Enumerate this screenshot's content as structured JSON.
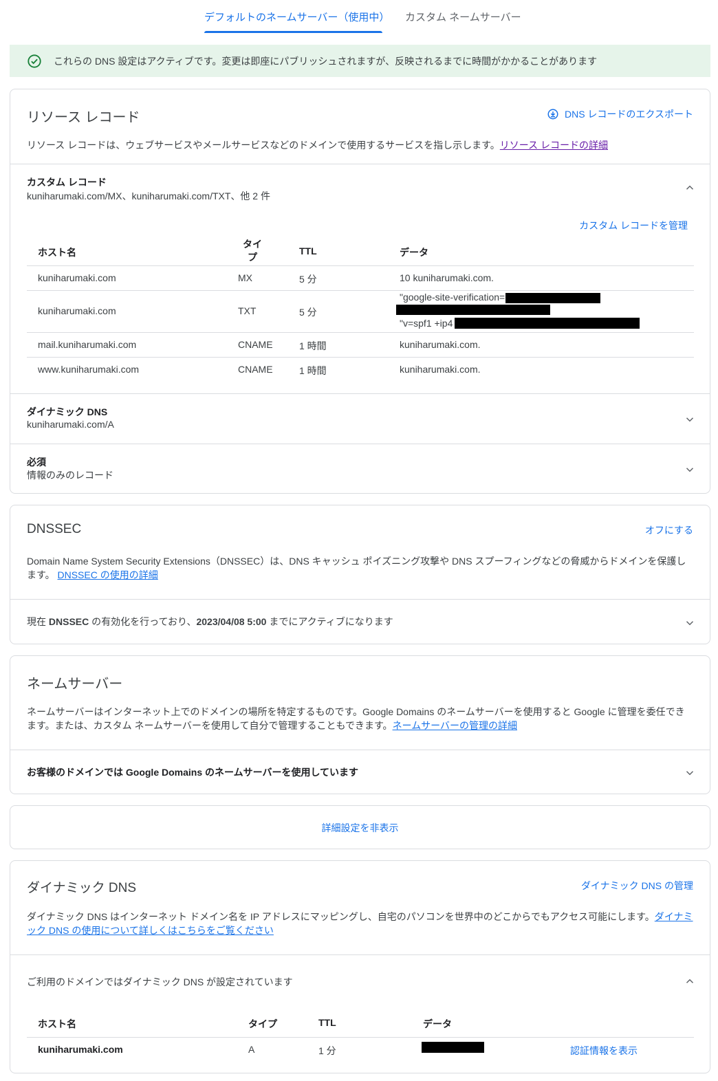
{
  "tabs": {
    "active": "デフォルトのネームサーバー（使用中）",
    "inactive": "カスタム ネームサーバー"
  },
  "banner": {
    "text": "これらの DNS 設定はアクティブです。変更は即座にパブリッシュされますが、反映されるまでに時間がかかることがあります",
    "icon": "check-circle-icon",
    "color": "#e6f4ea"
  },
  "resource_records": {
    "title": "リソース レコード",
    "export_label": "DNS レコードのエクスポート",
    "description": "リソース レコードは、ウェブサービスやメールサービスなどのドメインで使用するサービスを指し示します。",
    "learn_more": "リソース レコードの詳細",
    "custom": {
      "title": "カスタム レコード",
      "subtitle": "kuniharumaki.com/MX、kuniharumaki.com/TXT、他 2 件",
      "manage_label": "カスタム レコードを管理",
      "headers": {
        "host": "ホスト名",
        "type": "タイプ",
        "ttl": "TTL",
        "data": "データ"
      },
      "rows": [
        {
          "host": "kuniharumaki.com",
          "type": "MX",
          "ttl": "5 分",
          "data": "10 kuniharumaki.com."
        },
        {
          "host": "kuniharumaki.com",
          "type": "TXT",
          "ttl": "5 分",
          "data1": "\"google-site-verification=",
          "data2": "\"v=spf1 +ip4"
        },
        {
          "host": "mail.kuniharumaki.com",
          "type": "CNAME",
          "ttl": "1 時間",
          "data": "kuniharumaki.com."
        },
        {
          "host": "www.kuniharumaki.com",
          "type": "CNAME",
          "ttl": "1 時間",
          "data": "kuniharumaki.com."
        }
      ]
    },
    "dynamic": {
      "title": "ダイナミック DNS",
      "subtitle": "kuniharumaki.com/A"
    },
    "required": {
      "title": "必須",
      "subtitle": "情報のみのレコード"
    }
  },
  "dnssec": {
    "title": "DNSSEC",
    "action": "オフにする",
    "description": "Domain Name System Security Extensions（DNSSEC）は、DNS キャッシュ ポイズニング攻撃や DNS スプーフィングなどの脅威からドメインを保護します。",
    "learn_more": "DNSSEC の使用の詳細",
    "status_prefix": "現在 ",
    "status_b1": "DNSSEC",
    "status_mid": " の有効化を行っており、",
    "status_b2": "2023/04/08 5:00",
    "status_suffix": " までにアクティブになります"
  },
  "nameservers": {
    "title": "ネームサーバー",
    "description": "ネームサーバーはインターネット上でのドメインの場所を特定するものです。Google Domains のネームサーバーを使用すると Google に管理を委任できます。または、カスタム ネームサーバーを使用して自分で管理することもできます。",
    "learn_more": "ネームサーバーの管理の詳細",
    "status": "お客様のドメインでは Google Domains のネームサーバーを使用しています"
  },
  "advanced": {
    "toggle_label": "詳細設定を非表示"
  },
  "dynamic_dns": {
    "title": "ダイナミック DNS",
    "manage_label": "ダイナミック DNS の管理",
    "description": "ダイナミック DNS はインターネット ドメイン名を IP アドレスにマッピングし、自宅のパソコンを世界中のどこからでもアクセス可能にします。",
    "learn_more": "ダイナミック DNS の使用について詳しくはこちらをご覧ください",
    "status": "ご利用のドメインではダイナミック DNS が設定されています",
    "headers": {
      "host": "ホスト名",
      "type": "タイプ",
      "ttl": "TTL",
      "data": "データ"
    },
    "rows": [
      {
        "host": "kuniharumaki.com",
        "type": "A",
        "ttl": "1 分",
        "action": "認証情報を表示"
      }
    ]
  }
}
